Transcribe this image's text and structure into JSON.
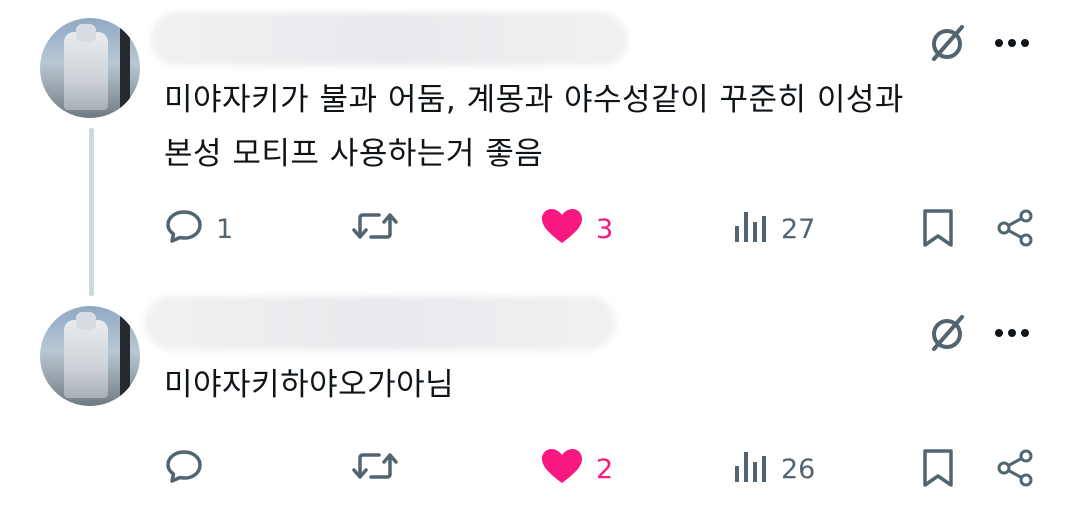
{
  "posts": [
    {
      "text": "미야자키가 불과 어둠, 계몽과 야수성같이 꾸준히 이성과\n본성 모티프 사용하는거 좋음",
      "actions": {
        "replies": "1",
        "reposts": "",
        "likes": "3",
        "views": "27"
      },
      "icons": [
        "grok-icon",
        "more-icon",
        "reply-icon",
        "repost-icon",
        "heart-icon",
        "views-icon",
        "bookmark-icon",
        "share-icon"
      ]
    },
    {
      "text": "미야자키하야오가아님",
      "actions": {
        "replies": "",
        "reposts": "",
        "likes": "2",
        "views": "26"
      },
      "icons": [
        "grok-icon",
        "more-icon",
        "reply-icon",
        "repost-icon",
        "heart-icon",
        "views-icon",
        "bookmark-icon",
        "share-icon"
      ]
    }
  ],
  "colors": {
    "like": "#f91880",
    "icon": "#536471",
    "thread_line": "#cfd9de"
  }
}
